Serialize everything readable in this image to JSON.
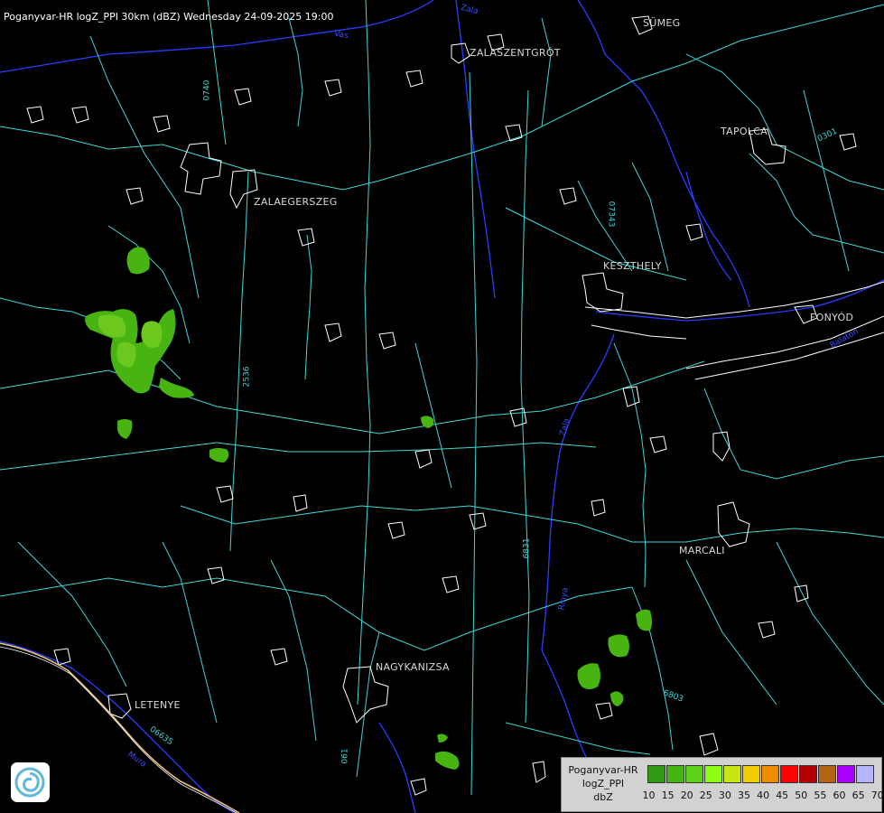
{
  "title": "Poganyvar-HR logZ_PPI 30km (dBZ) Wednesday 24-09-2025 19:00",
  "cities": [
    {
      "key": "sumeg",
      "name": "SÜMEG"
    },
    {
      "key": "zalaszentgrot",
      "name": "ZALASZENTGRÓT"
    },
    {
      "key": "tapolca",
      "name": "TAPOLCA"
    },
    {
      "key": "zalaegerszeg",
      "name": "ZALAEGERSZEG"
    },
    {
      "key": "keszthely",
      "name": "KESZTHELY"
    },
    {
      "key": "fonyod",
      "name": "FONYÓD"
    },
    {
      "key": "marcali",
      "name": "MARCALI"
    },
    {
      "key": "nagykanizsa",
      "name": "NAGYKANIZSA"
    },
    {
      "key": "letenye",
      "name": "LETENYE"
    }
  ],
  "road_labels": [
    "0740",
    "07343",
    "2536",
    "6831",
    "6803",
    "06635",
    "061",
    "0301"
  ],
  "water_labels": [
    "Zala",
    "Zala",
    "Balaton",
    "Rinya",
    "Vas",
    "Mura"
  ],
  "legend": {
    "line1": "Poganyvar-HR",
    "line2": "logZ_PPI",
    "line3": "dbZ",
    "colors": [
      "#2f9b14",
      "#48b412",
      "#5cd21a",
      "#8cff14",
      "#c8e614",
      "#f0cc00",
      "#f08c00",
      "#ff0000",
      "#b40000",
      "#b46414",
      "#aa00ff",
      "#b4b4ff"
    ],
    "ticks": [
      "10",
      "15",
      "20",
      "25",
      "30",
      "35",
      "40",
      "45",
      "50",
      "55",
      "60",
      "65",
      "70"
    ]
  },
  "colors": {
    "background": "#000000",
    "roads": "#3fd6d6",
    "borders": "#ffffff",
    "water": "#2a3cff",
    "echo_light": "#48b412",
    "echo_mid": "#6cc81e"
  }
}
